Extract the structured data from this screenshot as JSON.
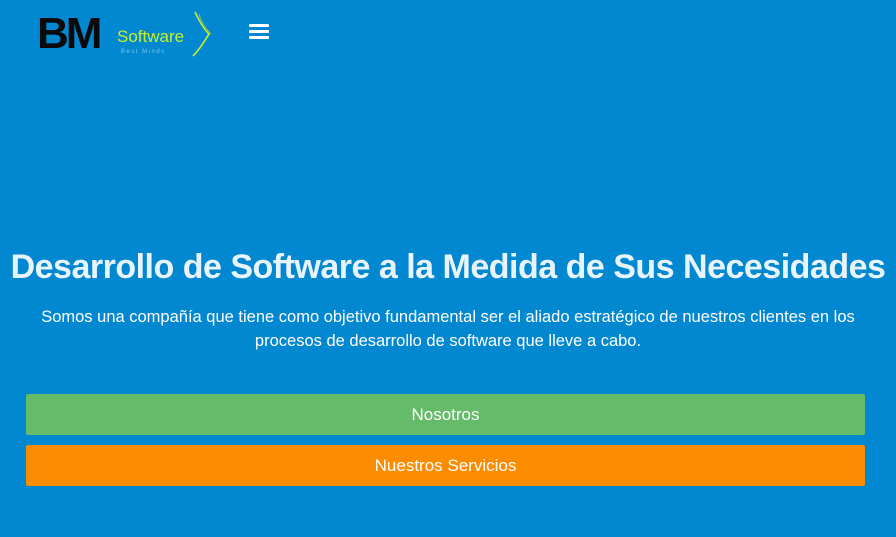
{
  "brand": {
    "initials": "BM",
    "word": "Software",
    "tagline": "Best Minds"
  },
  "nav": {
    "menu_icon": "hamburger-menu-icon"
  },
  "hero": {
    "title": "Desarrollo de Software a la Medida de Sus Necesidades",
    "description": "Somos una compañía que tiene como objetivo fundamental ser el aliado estratégico de nuestros clientes en los procesos de desarrollo de software que lleve a cabo."
  },
  "buttons": {
    "primary_label": "Nosotros",
    "secondary_label": "Nuestros Servicios"
  },
  "colors": {
    "background": "#0288d1",
    "primary_button": "#66bb6a",
    "secondary_button": "#fb8c00",
    "logo_accent": "#c6ef2b"
  }
}
